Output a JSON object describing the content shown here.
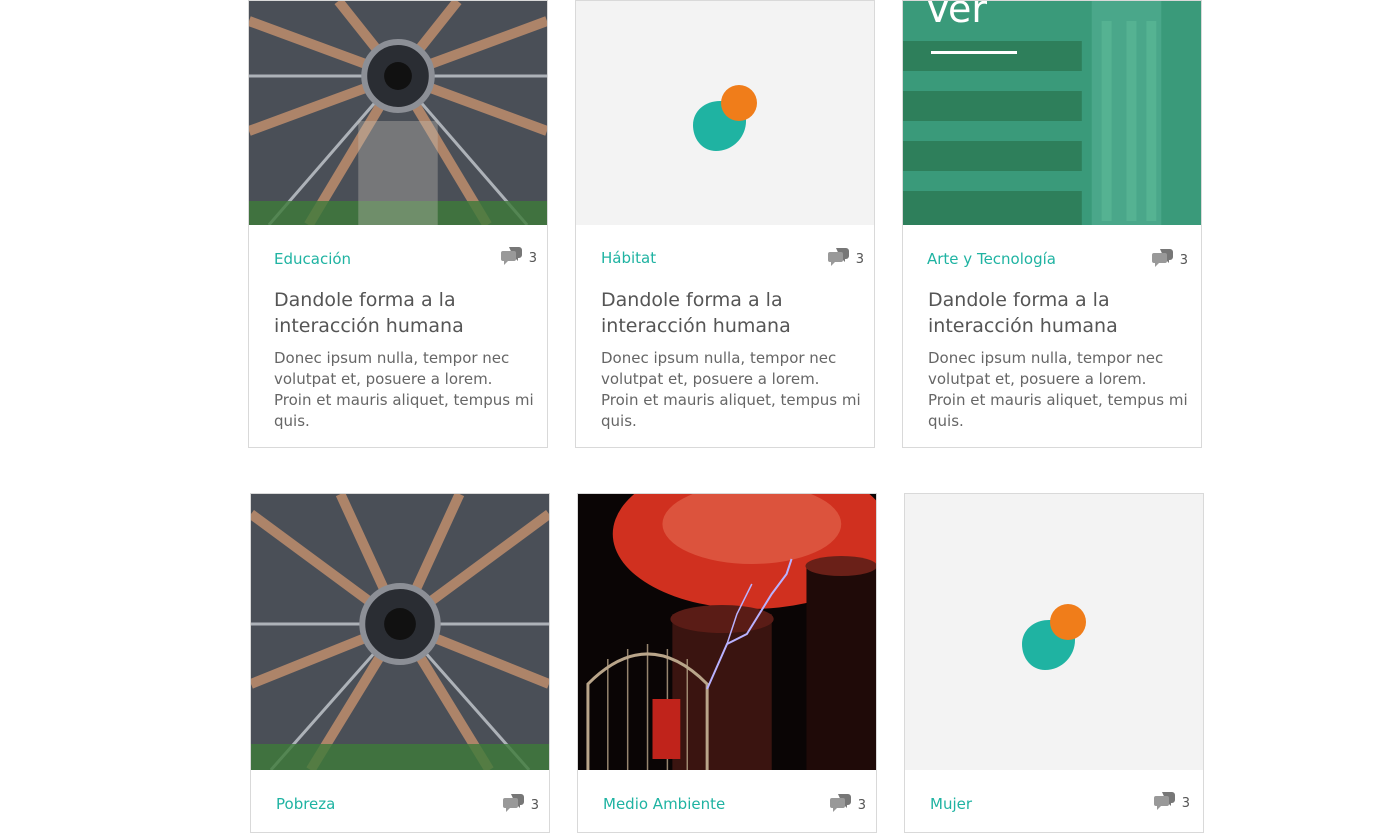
{
  "cards": [
    {
      "category": "Educación",
      "comments": "3",
      "title": "Dandole forma a la interacción humana",
      "description": "Donec ipsum nulla, tempor nec volutpat et, posuere a lorem. Proin et mauris aliquet, tempus mi quis.",
      "image": "particle-detector-image"
    },
    {
      "category": "Hábitat",
      "comments": "3",
      "title": "Dandole forma a la interacción humana",
      "description": "Donec ipsum nulla, tempor nec volutpat et, posuere a lorem. Proin et mauris aliquet, tempus mi quis.",
      "image": "brand-logo-placeholder"
    },
    {
      "category": "Arte y Tecnología",
      "comments": "3",
      "title": "Dandole forma a la interacción humana",
      "description": "Donec ipsum nulla, tempor nec volutpat et, posuere a lorem. Proin et mauris aliquet, tempus mi quis.",
      "image": "green-building-image",
      "overlay_text": "Ver"
    },
    {
      "category": "Pobreza",
      "comments": "3",
      "image": "particle-detector-image"
    },
    {
      "category": "Medio Ambiente",
      "comments": "3",
      "image": "tesla-coil-image"
    },
    {
      "category": "Mujer",
      "comments": "3",
      "image": "brand-logo-placeholder"
    }
  ],
  "colors": {
    "accent": "#1fb3a2",
    "logo_orange": "#f07d1a",
    "logo_teal": "#1fb3a2",
    "text": "#555555",
    "border": "#d9d9d9"
  }
}
